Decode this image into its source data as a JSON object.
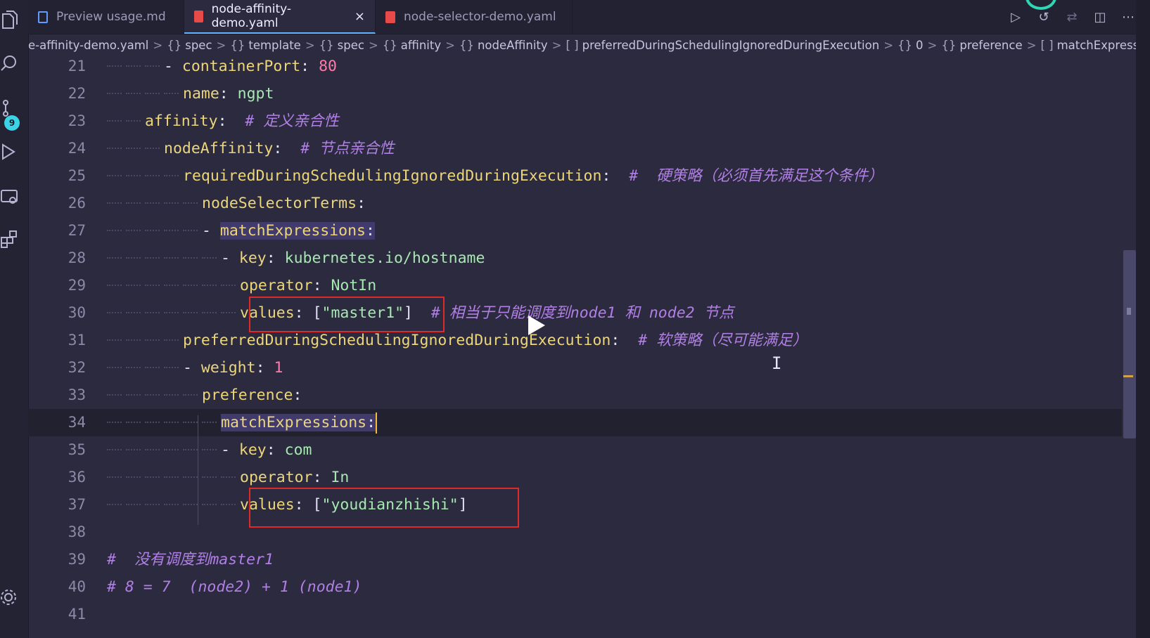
{
  "tabs": [
    {
      "label": "Preview usage.md",
      "icon": "markdown-preview-icon",
      "active": false
    },
    {
      "label": "node-affinity-demo.yaml",
      "icon": "yaml-file-icon",
      "active": true
    },
    {
      "label": "node-selector-demo.yaml",
      "icon": "yaml-file-icon",
      "active": false
    }
  ],
  "tab_close": "×",
  "activity": {
    "source_control_badge": "9"
  },
  "breadcrumb": [
    {
      "sym": "",
      "label": "e-affinity-demo.yaml"
    },
    {
      "sym": "{}",
      "label": "spec"
    },
    {
      "sym": "{}",
      "label": "template"
    },
    {
      "sym": "{}",
      "label": "spec"
    },
    {
      "sym": "{}",
      "label": "affinity"
    },
    {
      "sym": "{}",
      "label": "nodeAffinity"
    },
    {
      "sym": "[ ]",
      "label": "preferredDuringSchedulingIgnoredDuringExecution"
    },
    {
      "sym": "{}",
      "label": "0"
    },
    {
      "sym": "{}",
      "label": "preference"
    },
    {
      "sym": "[ ]",
      "label": "matchExpressions"
    }
  ],
  "editor": {
    "lines": [
      {
        "num": "21",
        "tokens": [
          [
            "p",
            "- "
          ],
          [
            "k",
            "containerPort"
          ],
          [
            "p",
            ": "
          ],
          [
            "n",
            "80"
          ]
        ]
      },
      {
        "num": "22",
        "tokens": [
          [
            "k",
            "name"
          ],
          [
            "p",
            ": "
          ],
          [
            "v",
            "ngpt"
          ]
        ]
      },
      {
        "num": "23",
        "tokens": [
          [
            "k",
            "affinity"
          ],
          [
            "p",
            ":  "
          ],
          [
            "c",
            "# 定义亲合性"
          ]
        ]
      },
      {
        "num": "24",
        "tokens": [
          [
            "k",
            "nodeAffinity"
          ],
          [
            "p",
            ":  "
          ],
          [
            "c",
            "# 节点亲合性"
          ]
        ]
      },
      {
        "num": "25",
        "tokens": [
          [
            "k",
            "requiredDuringSchedulingIgnoredDuringExecution"
          ],
          [
            "p",
            ":  "
          ],
          [
            "c",
            "#  硬策略（必须首先满足这个条件）"
          ]
        ]
      },
      {
        "num": "26",
        "tokens": [
          [
            "k",
            "nodeSelectorTerms"
          ],
          [
            "p",
            ":"
          ]
        ]
      },
      {
        "num": "27",
        "tokens": [
          [
            "p",
            "- "
          ],
          [
            "kh",
            "matchExpressions"
          ],
          [
            "ph",
            ":"
          ]
        ]
      },
      {
        "num": "28",
        "tokens": [
          [
            "p",
            "- "
          ],
          [
            "k",
            "key"
          ],
          [
            "p",
            ": "
          ],
          [
            "v",
            "kubernetes.io/hostname"
          ]
        ]
      },
      {
        "num": "29",
        "tokens": [
          [
            "k",
            "operator"
          ],
          [
            "p",
            ": "
          ],
          [
            "v",
            "NotIn"
          ]
        ]
      },
      {
        "num": "30",
        "tokens": [
          [
            "k",
            "values"
          ],
          [
            "p",
            ": ["
          ],
          [
            "s",
            "\"master1\""
          ],
          [
            "p",
            "]  "
          ],
          [
            "c",
            "# 相当于只能调度到node1 和 node2 节点"
          ]
        ]
      },
      {
        "num": "31",
        "tokens": [
          [
            "k",
            "preferredDuringSchedulingIgnoredDuringExecution"
          ],
          [
            "p",
            ":  "
          ],
          [
            "c",
            "# 软策略（尽可能满足）"
          ]
        ]
      },
      {
        "num": "32",
        "tokens": [
          [
            "p",
            "- "
          ],
          [
            "k",
            "weight"
          ],
          [
            "p",
            ": "
          ],
          [
            "n",
            "1"
          ]
        ]
      },
      {
        "num": "33",
        "tokens": [
          [
            "k",
            "preference"
          ],
          [
            "p",
            ":"
          ]
        ]
      },
      {
        "num": "34",
        "tokens": [
          [
            "kh",
            "matchExpressions"
          ],
          [
            "ph",
            ":"
          ]
        ]
      },
      {
        "num": "35",
        "tokens": [
          [
            "p",
            "- "
          ],
          [
            "k",
            "key"
          ],
          [
            "p",
            ": "
          ],
          [
            "v",
            "com"
          ]
        ]
      },
      {
        "num": "36",
        "tokens": [
          [
            "k",
            "operator"
          ],
          [
            "p",
            ": "
          ],
          [
            "v",
            "In"
          ]
        ]
      },
      {
        "num": "37",
        "tokens": [
          [
            "k",
            "values"
          ],
          [
            "p",
            ": ["
          ],
          [
            "s",
            "\"youdianzhishi\""
          ],
          [
            "p",
            "]"
          ]
        ]
      },
      {
        "num": "38",
        "tokens": []
      },
      {
        "num": "39",
        "tokens": [
          [
            "c",
            "#  没有调度到master1"
          ]
        ]
      },
      {
        "num": "40",
        "tokens": [
          [
            "c",
            "# 8 = 7  (node2) + 1 (node1)"
          ]
        ]
      },
      {
        "num": "41",
        "tokens": []
      }
    ]
  },
  "overlay": {
    "play_button": "play-icon",
    "ibeam": "I"
  },
  "colors": {
    "accent": "#63b4ff",
    "highlight_box": "#e02a2a",
    "key": "#ecd67b",
    "value": "#a6e9b0",
    "comment": "#b27fe6",
    "number": "#ff7ba9"
  }
}
